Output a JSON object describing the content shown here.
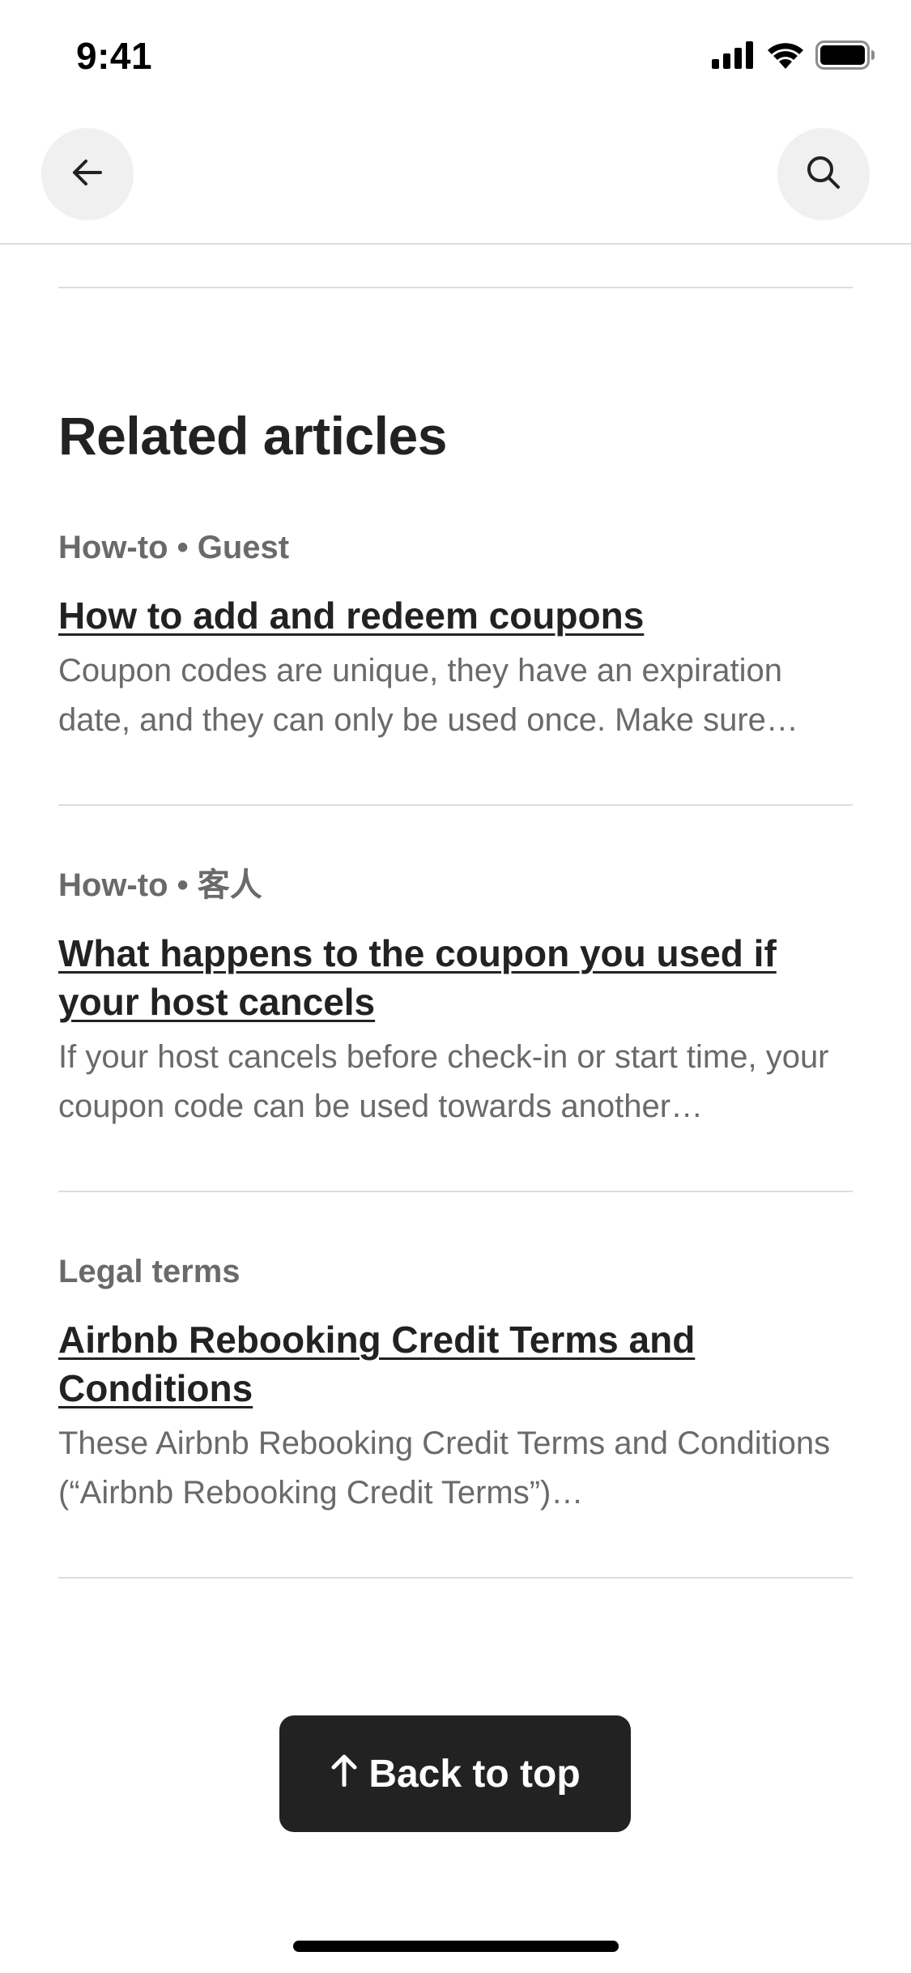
{
  "status_bar": {
    "time": "9:41",
    "icons": [
      "signal-icon",
      "wifi-icon",
      "battery-icon"
    ]
  },
  "nav": {
    "back_icon": "arrow-left-icon",
    "search_icon": "search-icon"
  },
  "section": {
    "title": "Related articles"
  },
  "articles": [
    {
      "meta": "How-to • Guest",
      "title": "How to add and redeem coupons",
      "description": "Coupon codes are unique, they have an expiration date, and they can only be used once. Make sure…"
    },
    {
      "meta": "How-to • 客人",
      "title": "What happens to the coupon you used if your host cancels",
      "description": "If your host cancels before check-in or start time, your coupon code can be used towards another…"
    },
    {
      "meta": "Legal terms",
      "title": "Airbnb Rebooking Credit Terms and Conditions",
      "description": "These Airbnb Rebooking Credit Terms and Conditions (“Airbnb Rebooking Credit Terms”)…"
    }
  ],
  "back_to_top": {
    "label": "Back to top",
    "icon": "arrow-up-icon"
  },
  "colors": {
    "text_primary": "#222222",
    "text_secondary": "#6a6a6a",
    "divider": "#dddddd",
    "button_bg": "#222222",
    "circle_bg": "#f0f0f0"
  }
}
